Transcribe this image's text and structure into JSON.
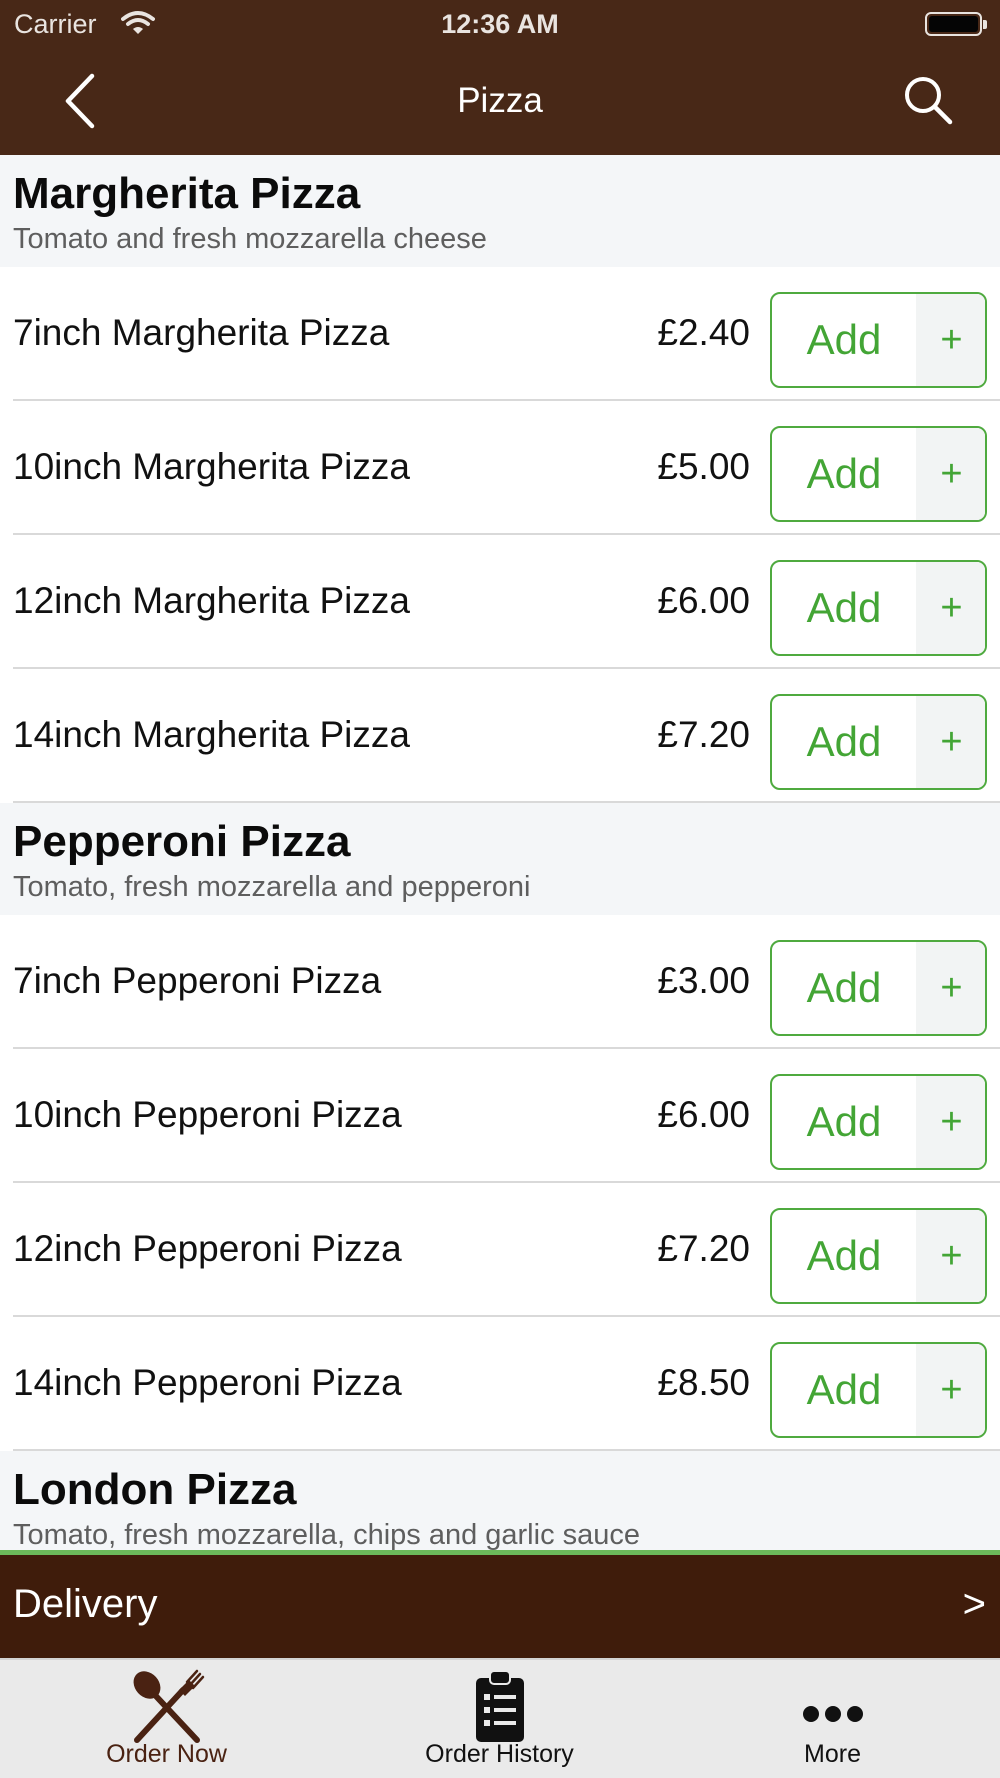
{
  "status_bar": {
    "carrier": "Carrier",
    "time": "12:36 AM"
  },
  "nav": {
    "title": "Pizza",
    "back_icon": "chevron-left-icon",
    "search_icon": "search-icon"
  },
  "colors": {
    "brand_brown": "#482817",
    "dark_brown": "#3f1c0b",
    "accent_green": "#43a535"
  },
  "sections": [
    {
      "title": "Margherita Pizza",
      "description": "Tomato and fresh mozzarella cheese",
      "items": [
        {
          "name": "7inch Margherita Pizza",
          "price": "£2.40",
          "add_label": "Add",
          "plus_label": "+"
        },
        {
          "name": "10inch Margherita Pizza",
          "price": "£5.00",
          "add_label": "Add",
          "plus_label": "+"
        },
        {
          "name": "12inch Margherita Pizza",
          "price": "£6.00",
          "add_label": "Add",
          "plus_label": "+"
        },
        {
          "name": "14inch Margherita Pizza",
          "price": "£7.20",
          "add_label": "Add",
          "plus_label": "+"
        }
      ]
    },
    {
      "title": "Pepperoni Pizza",
      "description": "Tomato, fresh mozzarella and pepperoni",
      "items": [
        {
          "name": "7inch Pepperoni Pizza",
          "price": "£3.00",
          "add_label": "Add",
          "plus_label": "+"
        },
        {
          "name": "10inch Pepperoni Pizza",
          "price": "£6.00",
          "add_label": "Add",
          "plus_label": "+"
        },
        {
          "name": "12inch Pepperoni Pizza",
          "price": "£7.20",
          "add_label": "Add",
          "plus_label": "+"
        },
        {
          "name": "14inch Pepperoni Pizza",
          "price": "£8.50",
          "add_label": "Add",
          "plus_label": "+"
        }
      ]
    },
    {
      "title": "London Pizza",
      "description": "Tomato, fresh mozzarella, chips and garlic sauce",
      "items": []
    }
  ],
  "delivery": {
    "label": "Delivery",
    "arrow": ">"
  },
  "tabs": [
    {
      "label": "Order Now",
      "icon": "fork-knife-icon",
      "active": true
    },
    {
      "label": "Order History",
      "icon": "clipboard-list-icon",
      "active": false
    },
    {
      "label": "More",
      "icon": "more-dots-icon",
      "active": false
    }
  ]
}
